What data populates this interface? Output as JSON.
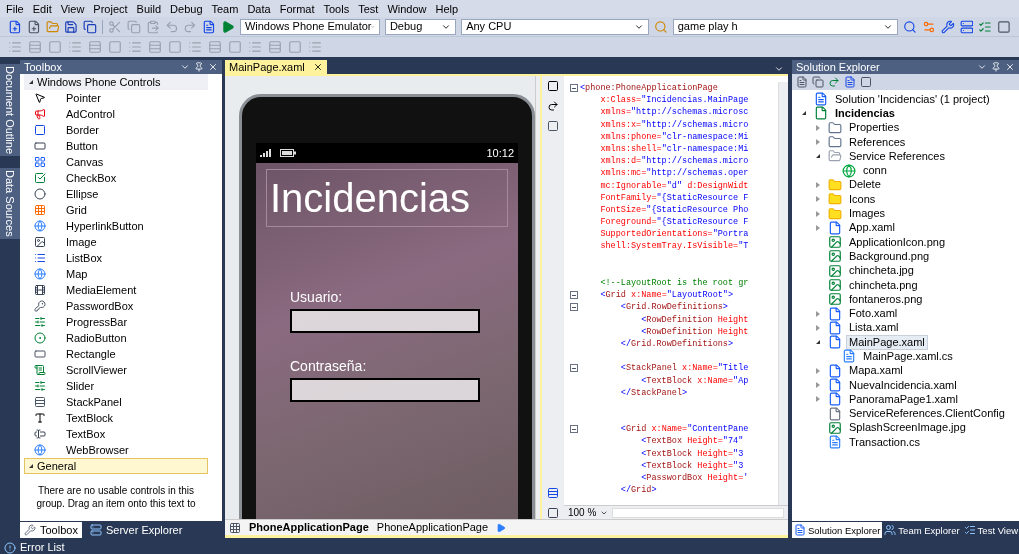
{
  "menu": [
    "File",
    "Edit",
    "View",
    "Project",
    "Build",
    "Debug",
    "Team",
    "Data",
    "Format",
    "Tools",
    "Test",
    "Window",
    "Help"
  ],
  "toolbar": {
    "dropdowns": [
      {
        "value": "Windows Phone Emulator"
      },
      {
        "value": "Debug"
      },
      {
        "value": "Any CPU"
      }
    ],
    "find": {
      "value": "game play h"
    }
  },
  "side_tabs": [
    {
      "label": "Document Outline",
      "selected": false
    },
    {
      "label": "Data Sources",
      "selected": false
    }
  ],
  "toolbox": {
    "title": "Toolbox",
    "groups": [
      {
        "label": "Windows Phone Controls",
        "expanded": true,
        "selected": false,
        "items": [
          {
            "label": "Pointer",
            "kind": "pointer"
          },
          {
            "label": "AdControl",
            "kind": "ad"
          },
          {
            "label": "Border",
            "kind": "border"
          },
          {
            "label": "Button",
            "kind": "button"
          },
          {
            "label": "Canvas",
            "kind": "canvas"
          },
          {
            "label": "CheckBox",
            "kind": "checkbox"
          },
          {
            "label": "Ellipse",
            "kind": "ellipse"
          },
          {
            "label": "Grid",
            "kind": "grid"
          },
          {
            "label": "HyperlinkButton",
            "kind": "web"
          },
          {
            "label": "Image",
            "kind": "image"
          },
          {
            "label": "ListBox",
            "kind": "list"
          },
          {
            "label": "Map",
            "kind": "web"
          },
          {
            "label": "MediaElement",
            "kind": "media"
          },
          {
            "label": "PasswordBox",
            "kind": "password"
          },
          {
            "label": "ProgressBar",
            "kind": "progress"
          },
          {
            "label": "RadioButton",
            "kind": "radio"
          },
          {
            "label": "Rectangle",
            "kind": "rectangle"
          },
          {
            "label": "ScrollViewer",
            "kind": "scroll"
          },
          {
            "label": "Slider",
            "kind": "slider"
          },
          {
            "label": "StackPanel",
            "kind": "stack"
          },
          {
            "label": "TextBlock",
            "kind": "textblock"
          },
          {
            "label": "TextBox",
            "kind": "textbox"
          },
          {
            "label": "WebBrowser",
            "kind": "web"
          }
        ]
      },
      {
        "label": "General",
        "expanded": true,
        "selected": true,
        "message": "There are no usable controls in this group. Drag an item onto this text to"
      }
    ],
    "tabs": [
      {
        "label": "Toolbox",
        "selected": true
      },
      {
        "label": "Server Explorer",
        "selected": false
      }
    ]
  },
  "document_tabs": [
    {
      "label": "MainPage.xaml",
      "selected": true
    }
  ],
  "designer": {
    "time": "10:12",
    "title": "Incidencias",
    "fields": [
      {
        "label": "Usuario:"
      },
      {
        "label": "Contraseña:"
      }
    ]
  },
  "xaml_editor": {
    "zoom": "100 %",
    "lines": [
      {
        "kind": "code",
        "fold": true,
        "segments": [
          {
            "kind": "punct",
            "text": "<"
          },
          {
            "kind": "tag",
            "text": "phone:PhoneApplicationPage"
          }
        ]
      },
      {
        "kind": "code",
        "fold": false,
        "segments": [
          {
            "kind": "attr",
            "text": "    x:Class="
          },
          {
            "kind": "value",
            "text": "\"Incidencias.MainPage"
          }
        ]
      },
      {
        "kind": "code",
        "fold": false,
        "segments": [
          {
            "kind": "attr",
            "text": "    xmlns="
          },
          {
            "kind": "value",
            "text": "\"http://schemas.microsc"
          }
        ]
      },
      {
        "kind": "code",
        "fold": false,
        "segments": [
          {
            "kind": "attr",
            "text": "    xmlns:x="
          },
          {
            "kind": "value",
            "text": "\"http://schemas.micro"
          }
        ]
      },
      {
        "kind": "code",
        "fold": false,
        "segments": [
          {
            "kind": "attr",
            "text": "    xmlns:phone="
          },
          {
            "kind": "value",
            "text": "\"clr-namespace:Mi"
          }
        ]
      },
      {
        "kind": "code",
        "fold": false,
        "segments": [
          {
            "kind": "attr",
            "text": "    xmlns:shell="
          },
          {
            "kind": "value",
            "text": "\"clr-namespace:Mi"
          }
        ]
      },
      {
        "kind": "code",
        "fold": false,
        "segments": [
          {
            "kind": "attr",
            "text": "    xmlns:d="
          },
          {
            "kind": "value",
            "text": "\"http://schemas.micro"
          }
        ]
      },
      {
        "kind": "code",
        "fold": false,
        "segments": [
          {
            "kind": "attr",
            "text": "    xmlns:mc="
          },
          {
            "kind": "value",
            "text": "\"http://schemas.oper"
          }
        ]
      },
      {
        "kind": "code",
        "fold": false,
        "segments": [
          {
            "kind": "attr",
            "text": "    mc:Ignorable="
          },
          {
            "kind": "value",
            "text": "\"d\" "
          },
          {
            "kind": "attr",
            "text": "d:DesignWidt"
          }
        ]
      },
      {
        "kind": "code",
        "fold": false,
        "segments": [
          {
            "kind": "attr",
            "text": "    FontFamily="
          },
          {
            "kind": "value",
            "text": "\"{StaticResource F"
          }
        ]
      },
      {
        "kind": "code",
        "fold": false,
        "segments": [
          {
            "kind": "attr",
            "text": "    FontSize="
          },
          {
            "kind": "value",
            "text": "\"{StaticResource Pho"
          }
        ]
      },
      {
        "kind": "code",
        "fold": false,
        "segments": [
          {
            "kind": "attr",
            "text": "    Foreground="
          },
          {
            "kind": "value",
            "text": "\"{StaticResource F"
          }
        ]
      },
      {
        "kind": "code",
        "fold": false,
        "segments": [
          {
            "kind": "attr",
            "text": "    SupportedOrientations="
          },
          {
            "kind": "value",
            "text": "\"Portra"
          }
        ]
      },
      {
        "kind": "code",
        "fold": false,
        "segments": [
          {
            "kind": "attr",
            "text": "    shell:SystemTray.IsVisible="
          },
          {
            "kind": "value",
            "text": "\"T"
          }
        ]
      },
      {
        "kind": "blank"
      },
      {
        "kind": "blank"
      },
      {
        "kind": "code",
        "fold": false,
        "segments": [
          {
            "kind": "comment",
            "text": "    <!--LayoutRoot is the root gr"
          }
        ]
      },
      {
        "kind": "code",
        "fold": true,
        "segments": [
          {
            "kind": "punct",
            "text": "    <"
          },
          {
            "kind": "tag",
            "text": "Grid "
          },
          {
            "kind": "attr",
            "text": "x:Name="
          },
          {
            "kind": "value",
            "text": "\"LayoutRoot\">"
          }
        ]
      },
      {
        "kind": "code",
        "fold": true,
        "segments": [
          {
            "kind": "punct",
            "text": "        <"
          },
          {
            "kind": "tag",
            "text": "Grid.RowDefinitions"
          },
          {
            "kind": "punct",
            "text": ">"
          }
        ]
      },
      {
        "kind": "code",
        "fold": false,
        "segments": [
          {
            "kind": "punct",
            "text": "            <"
          },
          {
            "kind": "tag",
            "text": "RowDefinition "
          },
          {
            "kind": "attr",
            "text": "Height"
          }
        ]
      },
      {
        "kind": "code",
        "fold": false,
        "segments": [
          {
            "kind": "punct",
            "text": "            <"
          },
          {
            "kind": "tag",
            "text": "RowDefinition "
          },
          {
            "kind": "attr",
            "text": "Height"
          }
        ]
      },
      {
        "kind": "code",
        "fold": false,
        "segments": [
          {
            "kind": "punct",
            "text": "        </"
          },
          {
            "kind": "tag",
            "text": "Grid.RowDefinitions"
          },
          {
            "kind": "punct",
            "text": ">"
          }
        ]
      },
      {
        "kind": "blank"
      },
      {
        "kind": "code",
        "fold": true,
        "segments": [
          {
            "kind": "punct",
            "text": "        <"
          },
          {
            "kind": "tag",
            "text": "StackPanel "
          },
          {
            "kind": "attr",
            "text": "x:Name="
          },
          {
            "kind": "value",
            "text": "\"Title"
          }
        ]
      },
      {
        "kind": "code",
        "fold": false,
        "segments": [
          {
            "kind": "punct",
            "text": "            <"
          },
          {
            "kind": "tag",
            "text": "TextBlock "
          },
          {
            "kind": "attr",
            "text": "x:Name="
          },
          {
            "kind": "value",
            "text": "\"Ap"
          }
        ]
      },
      {
        "kind": "code",
        "fold": false,
        "segments": [
          {
            "kind": "punct",
            "text": "        </"
          },
          {
            "kind": "tag",
            "text": "StackPanel"
          },
          {
            "kind": "punct",
            "text": ">"
          }
        ]
      },
      {
        "kind": "blank"
      },
      {
        "kind": "blank"
      },
      {
        "kind": "code",
        "fold": true,
        "segments": [
          {
            "kind": "punct",
            "text": "        <"
          },
          {
            "kind": "tag",
            "text": "Grid "
          },
          {
            "kind": "attr",
            "text": "x:Name="
          },
          {
            "kind": "value",
            "text": "\"ContentPane"
          }
        ]
      },
      {
        "kind": "code",
        "fold": false,
        "segments": [
          {
            "kind": "punct",
            "text": "            <"
          },
          {
            "kind": "tag",
            "text": "TextBox "
          },
          {
            "kind": "attr",
            "text": "Height="
          },
          {
            "kind": "value",
            "text": "\"74\""
          }
        ]
      },
      {
        "kind": "code",
        "fold": false,
        "segments": [
          {
            "kind": "punct",
            "text": "            <"
          },
          {
            "kind": "tag",
            "text": "TextBlock "
          },
          {
            "kind": "attr",
            "text": "Height="
          },
          {
            "kind": "value",
            "text": "\"3"
          }
        ]
      },
      {
        "kind": "code",
        "fold": false,
        "segments": [
          {
            "kind": "punct",
            "text": "            <"
          },
          {
            "kind": "tag",
            "text": "TextBlock "
          },
          {
            "kind": "attr",
            "text": "Height="
          },
          {
            "kind": "value",
            "text": "\"3"
          }
        ]
      },
      {
        "kind": "code",
        "fold": false,
        "segments": [
          {
            "kind": "punct",
            "text": "            <"
          },
          {
            "kind": "tag",
            "text": "PasswordBox "
          },
          {
            "kind": "attr",
            "text": "Height="
          },
          {
            "kind": "value",
            "text": "'"
          }
        ]
      },
      {
        "kind": "code",
        "fold": false,
        "segments": [
          {
            "kind": "punct",
            "text": "        </"
          },
          {
            "kind": "tag",
            "text": "Grid"
          },
          {
            "kind": "punct",
            "text": ">"
          }
        ]
      }
    ]
  },
  "breadcrumb": [
    {
      "label": "PhoneApplicationPage",
      "bold": true
    },
    {
      "label": "PhoneApplicationPage",
      "bold": false
    }
  ],
  "solution_explorer": {
    "title": "Solution Explorer",
    "tree": [
      {
        "label": "Solution 'Incidencias' (1 project)",
        "kind": "solution",
        "selected": false,
        "children": [
          {
            "label": "Incidencias",
            "kind": "project",
            "expanded": true,
            "selected": false,
            "children": [
              {
                "label": "Properties",
                "kind": "properties",
                "expanded": false,
                "selected": false
              },
              {
                "label": "References",
                "kind": "properties",
                "expanded": false,
                "selected": false
              },
              {
                "label": "Service References",
                "kind": "open-folder",
                "expanded": true,
                "selected": false,
                "children": [
                  {
                    "label": "conn",
                    "kind": "service",
                    "selected": false
                  }
                ]
              },
              {
                "label": "Delete",
                "kind": "folder",
                "expanded": false,
                "selected": false
              },
              {
                "label": "Icons",
                "kind": "folder",
                "expanded": false,
                "selected": false
              },
              {
                "label": "Images",
                "kind": "folder",
                "expanded": false,
                "selected": false
              },
              {
                "label": "App.xaml",
                "kind": "xaml",
                "expanded": false,
                "selected": false
              },
              {
                "label": "ApplicationIcon.png",
                "kind": "image",
                "selected": false
              },
              {
                "label": "Background.png",
                "kind": "image",
                "selected": false
              },
              {
                "label": "chincheta.jpg",
                "kind": "image",
                "selected": false
              },
              {
                "label": "chincheta.png",
                "kind": "image",
                "selected": false
              },
              {
                "label": "fontaneros.png",
                "kind": "image",
                "selected": false
              },
              {
                "label": "Foto.xaml",
                "kind": "xaml",
                "expanded": false,
                "selected": false
              },
              {
                "label": "Lista.xaml",
                "kind": "xaml",
                "expanded": false,
                "selected": false
              },
              {
                "label": "MainPage.xaml",
                "kind": "xaml",
                "expanded": true,
                "selected": true,
                "children": [
                  {
                    "label": "MainPage.xaml.cs",
                    "kind": "code",
                    "selected": false
                  }
                ]
              },
              {
                "label": "Mapa.xaml",
                "kind": "xaml",
                "expanded": false,
                "selected": false
              },
              {
                "label": "NuevaIncidencia.xaml",
                "kind": "xaml",
                "expanded": false,
                "selected": false
              },
              {
                "label": "PanoramaPage1.xaml",
                "kind": "xaml",
                "expanded": false,
                "selected": false
              },
              {
                "label": "ServiceReferences.ClientConfig",
                "kind": "file",
                "selected": false
              },
              {
                "label": "SplashScreenImage.jpg",
                "kind": "image",
                "selected": false
              },
              {
                "label": "Transaction.cs",
                "kind": "code",
                "selected": false
              }
            ]
          }
        ]
      }
    ],
    "tabs": [
      {
        "label": "Solution Explorer",
        "selected": true
      },
      {
        "label": "Team Explorer",
        "selected": false
      },
      {
        "label": "Test View",
        "selected": false
      }
    ]
  },
  "bottom_tabs": [
    {
      "label": "Error List"
    }
  ]
}
